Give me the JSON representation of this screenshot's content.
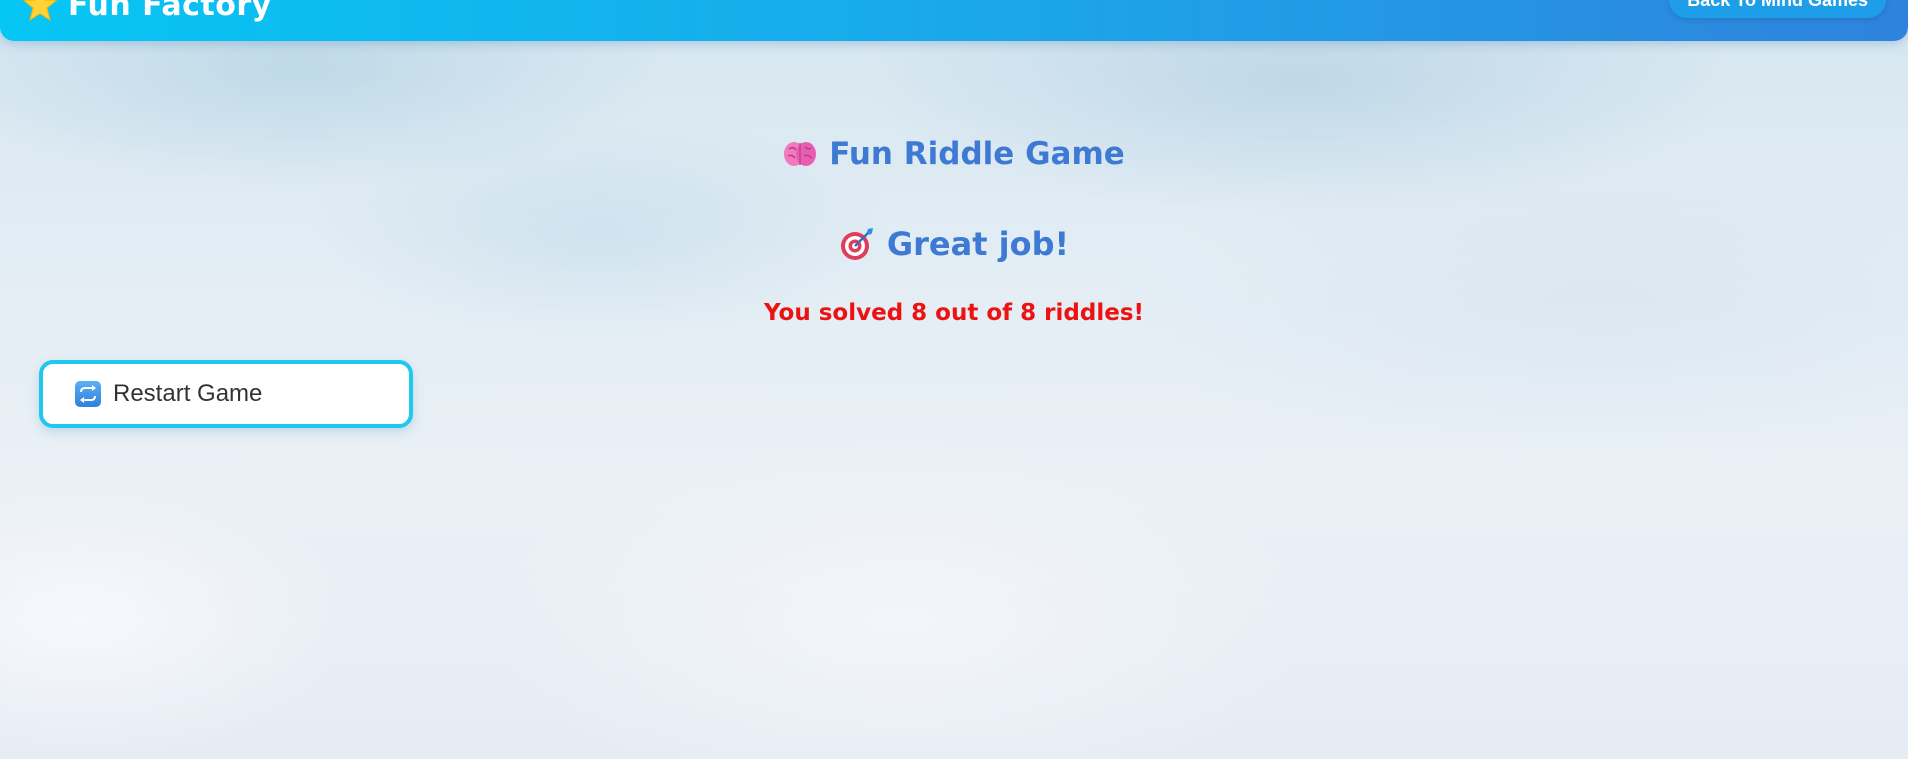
{
  "header": {
    "brand_name": "Fun Factory",
    "brand_icon": "star-icon",
    "back_button_label": "Back To Mind Games",
    "gradient_start": "#06c6f4",
    "gradient_end": "#2f83dc"
  },
  "game": {
    "title": "Fun Riddle Game",
    "title_icon": "brain-icon",
    "result_title": "Great job!",
    "result_icon": "target-icon",
    "score_text": "You solved 8 out of 8 riddles!",
    "solved": 8,
    "total": 8,
    "title_color": "#3e79d4",
    "score_color": "#ee1111"
  },
  "actions": {
    "restart_label": "Restart Game",
    "restart_icon": "repeat-icon",
    "border_color": "#1ec8ee"
  }
}
